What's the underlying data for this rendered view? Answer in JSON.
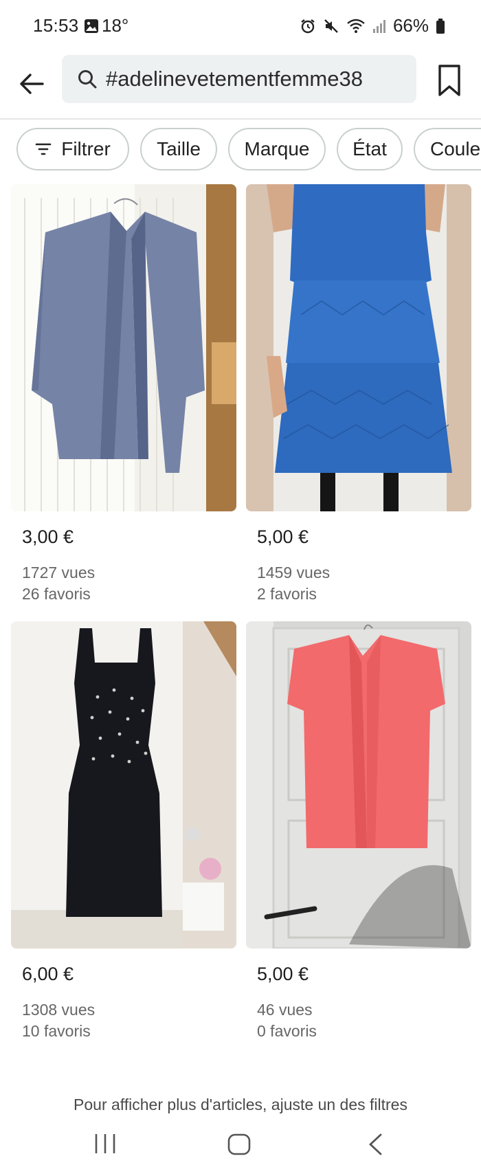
{
  "status_bar": {
    "time": "15:53",
    "temperature": "18°",
    "battery": "66%",
    "icons": [
      "gallery-icon",
      "alarm-icon",
      "mute-icon",
      "wifi-icon",
      "signal-icon",
      "battery-icon"
    ]
  },
  "search": {
    "query": "#adelinevetementfemme38",
    "icons": [
      "back-arrow-icon",
      "search-icon",
      "bookmark-icon"
    ]
  },
  "filters": [
    {
      "label": "Filtrer",
      "icon": "filter-icon"
    },
    {
      "label": "Taille"
    },
    {
      "label": "Marque"
    },
    {
      "label": "État"
    },
    {
      "label": "Couleur"
    }
  ],
  "products": [
    {
      "price": "3,00 €",
      "views": "1727 vues",
      "favorites": "26 favoris",
      "image": "blue-grey cardigan on hanger"
    },
    {
      "price": "5,00 €",
      "views": "1459 vues",
      "favorites": "2 favoris",
      "image": "blue eyelet dress worn"
    },
    {
      "price": "6,00 €",
      "views": "1308 vues",
      "favorites": "10 favoris",
      "image": "black sleeveless dress on door"
    },
    {
      "price": "5,00 €",
      "views": "46 vues",
      "favorites": "0 favoris",
      "image": "pink sleeveless blouse on door"
    }
  ],
  "footer_note": "Pour afficher plus d'articles, ajuste un des filtres",
  "colors": {
    "chip_border": "#c9cfcf",
    "search_bg": "#eef1f1",
    "text_secondary": "#666666"
  }
}
